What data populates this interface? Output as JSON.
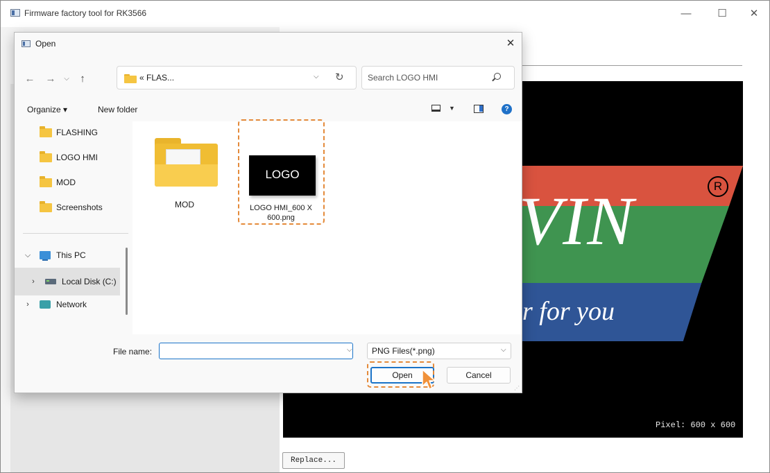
{
  "app": {
    "title": "Firmware factory tool for RK3566",
    "minimize_glyph": "—",
    "maximize_glyph": "☐",
    "close_glyph": "✕",
    "preview": {
      "logo_word": "VIN",
      "logo_slogan": "r for you",
      "registered_mark": "R",
      "pixel_label": "Pixel: 600 x 600"
    },
    "replace_label": "Replace..."
  },
  "dialog": {
    "title": "Open",
    "close_glyph": "✕",
    "nav": {
      "back_glyph": "←",
      "forward_glyph": "→",
      "recent_glyph": "⌵",
      "up_glyph": "↑"
    },
    "address": {
      "path": "« FLAS...",
      "chevron": "⌵",
      "refresh_glyph": "↻"
    },
    "search": {
      "placeholder": "Search LOGO HMI"
    },
    "command_bar": {
      "organize_label": "Organize ▾",
      "new_folder_label": "New folder",
      "view_caret": "▼",
      "help_glyph": "?"
    },
    "nav_pane": {
      "quick_access": [
        "FLASHING",
        "LOGO HMI",
        "MOD",
        "Screenshots"
      ],
      "this_pc": "This PC",
      "local_disk": "Local Disk (C:)",
      "network": "Network",
      "expanded_chevron": "⌵",
      "collapsed_chevron": "›"
    },
    "files": [
      {
        "name": "MOD",
        "kind": "folder"
      },
      {
        "name": "LOGO HMI_600 X 600.png",
        "name_line1": "LOGO HMI_600 X",
        "name_line2": "600.png",
        "thumb_text": "LOGO",
        "kind": "png"
      }
    ],
    "file_name": {
      "label": "File name:",
      "value": "",
      "chevron": "⌵"
    },
    "file_type": {
      "value": "PNG Files(*.png)",
      "chevron": "⌵"
    },
    "open_label": "Open",
    "cancel_label": "Cancel"
  },
  "colors": {
    "highlight": "#e48a3a",
    "accent": "#1a73c8",
    "logo_red": "#d9533f",
    "logo_green": "#3f9450",
    "logo_blue": "#2f5596",
    "folder": "#f5c542"
  }
}
